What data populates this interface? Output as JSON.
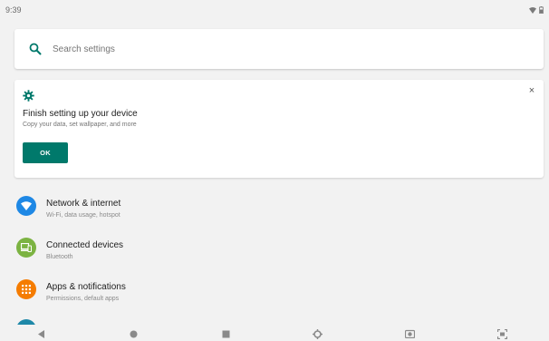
{
  "status_bar": {
    "time": "9:39"
  },
  "search": {
    "placeholder": "Search settings"
  },
  "suggestion": {
    "title": "Finish setting up your device",
    "subtitle": "Copy your data, set wallpaper, and more",
    "ok_label": "OK",
    "close_glyph": "×"
  },
  "settings": {
    "items": [
      {
        "title": "Network & internet",
        "subtitle": "Wi-Fi, data usage, hotspot",
        "icon": "wifi-icon",
        "color": "#1e88e5"
      },
      {
        "title": "Connected devices",
        "subtitle": "Bluetooth",
        "icon": "devices-icon",
        "color": "#7cb342"
      },
      {
        "title": "Apps & notifications",
        "subtitle": "Permissions, default apps",
        "icon": "apps-icon",
        "color": "#f57c00"
      }
    ]
  },
  "colors": {
    "accent": "#00796b",
    "background": "#f2f2f2"
  }
}
